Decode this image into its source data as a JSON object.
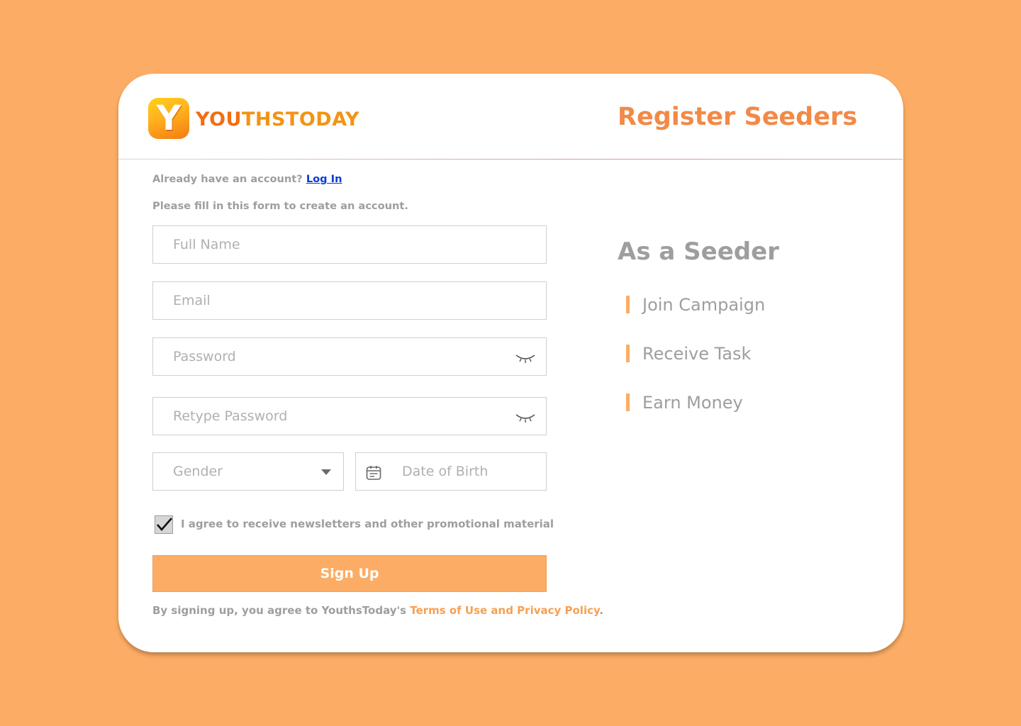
{
  "brand": {
    "logo_letter": "Y",
    "name_part1": "YOU",
    "name_part2": "THSTODAY"
  },
  "header": {
    "title": "Register Seeders"
  },
  "form": {
    "already_text": "Already have an account?",
    "login_link": "Log In",
    "instructions": "Please fill in this form to create an account.",
    "full_name_placeholder": "Full Name",
    "email_placeholder": "Email",
    "password_placeholder": "Password",
    "retype_password_placeholder": "Retype Password",
    "gender_placeholder": "Gender",
    "dob_placeholder": "Date of Birth",
    "newsletter_label": "I agree to receive newsletters and other promotional material",
    "newsletter_checked": true,
    "signup_label": "Sign Up",
    "terms_prefix": "By signing up, you agree to YouthsToday's",
    "terms_link": "Terms of Use and Privacy Policy",
    "terms_suffix": "."
  },
  "seeder": {
    "heading": "As a Seeder",
    "benefits": [
      "Join Campaign",
      "Receive Task",
      "Earn Money"
    ]
  },
  "colors": {
    "background": "#FCAC64",
    "title": "#F28A47",
    "accent": "#FCAC64",
    "link": "#0A3BD6",
    "terms_link": "#F6A052",
    "muted_text": "#9E9E9E"
  },
  "icons": {
    "password_toggle": "eye-closed-icon",
    "gender_dropdown": "caret-down-icon",
    "date": "calendar-icon",
    "checkbox": "checkmark-icon"
  }
}
